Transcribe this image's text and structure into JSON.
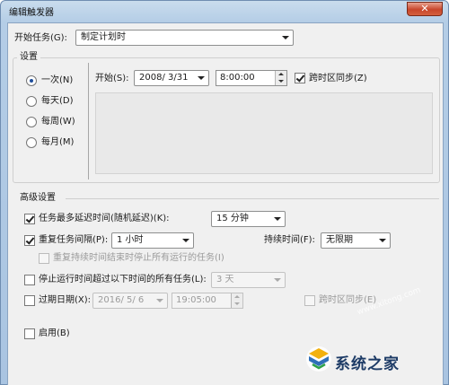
{
  "window": {
    "title": "编辑触发器",
    "close_glyph": "✕"
  },
  "begin_task": {
    "label": "开始任务(G):",
    "value": "制定计划时"
  },
  "settings": {
    "group_label": "设置",
    "schedule_options": [
      {
        "label": "一次(N)",
        "selected": true
      },
      {
        "label": "每天(D)",
        "selected": false
      },
      {
        "label": "每周(W)",
        "selected": false
      },
      {
        "label": "每月(M)",
        "selected": false
      }
    ],
    "start_label": "开始(S):",
    "start_date": "2008/ 3/31",
    "start_time": "8:00:00",
    "sync_timezone_label": "跨时区同步(Z)",
    "sync_timezone_checked": true
  },
  "advanced": {
    "group_label": "高级设置",
    "delay": {
      "label": "任务最多延迟时间(随机延迟)(K):",
      "checked": true,
      "value": "15 分钟"
    },
    "repeat": {
      "label": "重复任务间隔(P):",
      "checked": true,
      "value": "1 小时",
      "duration_label": "持续时间(F):",
      "duration_value": "无限期"
    },
    "stop_running": {
      "label": "重复持续时间结束时停止所有运行的任务(I)",
      "checked": false
    },
    "stop_longer": {
      "label": "停止运行时间超过以下时间的所有任务(L):",
      "checked": false,
      "value": "3 天"
    },
    "expire": {
      "label": "过期日期(X):",
      "checked": false,
      "date": "2016/ 5/ 6",
      "time": "19:05:00",
      "sync_label": "跨时区同步(E)",
      "sync_checked": false
    },
    "enabled": {
      "label": "启用(B)",
      "checked": false
    }
  },
  "watermark": {
    "text": "系统之家",
    "url": "www.xitong.com"
  },
  "colors": {
    "frame": "#b4cde6",
    "client": "#f0f0f0",
    "close": "#c8462b",
    "watermark": "#1d3b66"
  }
}
